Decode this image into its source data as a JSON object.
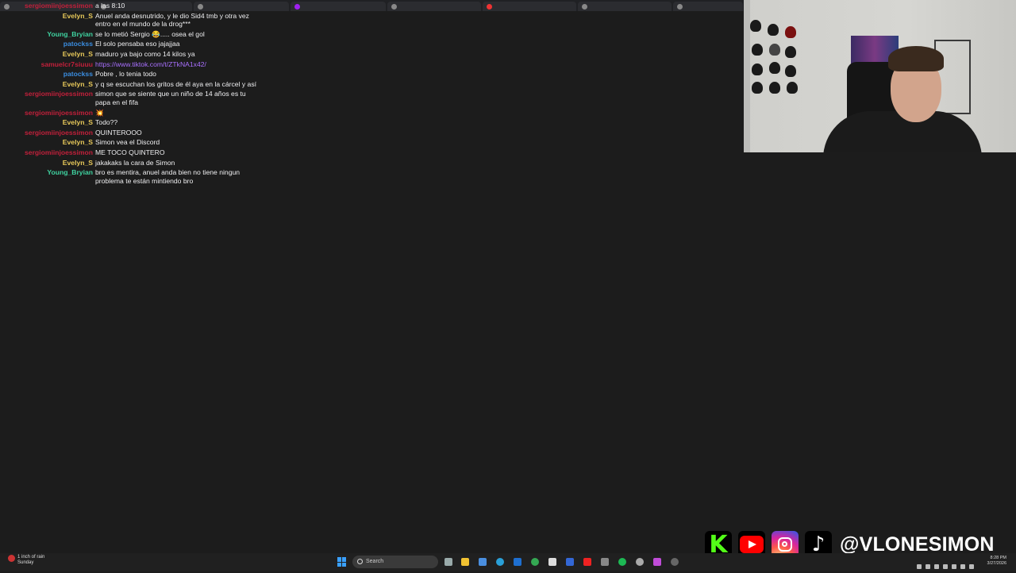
{
  "chat": {
    "messages": [
      {
        "user": "sergiomiinjoessimon",
        "color": "#c2203b",
        "text": "a las 8:10",
        "link": false
      },
      {
        "user": "Evelyn_S",
        "color": "#e8c95a",
        "text": "Anuel anda desnutrido, y le dio Sid4 tmb y otra vez entro en el mundo de la drog***",
        "link": false
      },
      {
        "user": "Young_Bryian",
        "color": "#3fd2a0",
        "text": "se lo metió Sergio 😂..... osea el gol",
        "link": false
      },
      {
        "user": "patockss",
        "color": "#3a8de0",
        "text": "El solo pensaba eso jajajjaa",
        "link": false
      },
      {
        "user": "Evelyn_S",
        "color": "#e8c95a",
        "text": "maduro ya bajo como 14 kilos ya",
        "link": false
      },
      {
        "user": "samuelcr7siuuu",
        "color": "#c2203b",
        "text": "https://www.tiktok.com/t/ZTkNA1x42/",
        "link": true
      },
      {
        "user": "patockss",
        "color": "#3a8de0",
        "text": "Pobre , lo tenia todo",
        "link": false
      },
      {
        "user": "Evelyn_S",
        "color": "#e8c95a",
        "text": "y q se escuchan los gritos de él aya en la cárcel y así",
        "link": false
      },
      {
        "user": "sergiomiinjoessimon",
        "color": "#c2203b",
        "text": "simon que se siente que un niño de 14 años es tu papa en el fifa",
        "link": false
      },
      {
        "user": "sergiomiinjoessimon",
        "color": "#c2203b",
        "text": "💥",
        "link": false
      },
      {
        "user": "Evelyn_S",
        "color": "#e8c95a",
        "text": "Todo??",
        "link": false
      },
      {
        "user": "sergiomiinjoessimon",
        "color": "#c2203b",
        "text": "QUINTEROOO",
        "link": false
      },
      {
        "user": "Evelyn_S",
        "color": "#e8c95a",
        "text": "Simon vea el Discord",
        "link": false
      },
      {
        "user": "sergiomiinjoessimon",
        "color": "#c2203b",
        "text": "ME TOCO QUINTERO",
        "link": false
      },
      {
        "user": "Evelyn_S",
        "color": "#e8c95a",
        "text": "jakakaks la cara de Simon",
        "link": false
      },
      {
        "user": "Young_Bryian",
        "color": "#3fd2a0",
        "text": "bro es mentira, anuel anda bien no tiene ningun problema te están mintiendo bro",
        "link": false
      }
    ]
  },
  "overlay": {
    "handle": "@VLONESIMON",
    "icons": [
      "kick-icon",
      "youtube-icon",
      "instagram-icon",
      "tiktok-icon"
    ]
  },
  "taskbar": {
    "weather_line1": "1 inch of rain",
    "weather_line2": "Sunday",
    "search_placeholder": "Search",
    "time": "8:28 PM",
    "date": "3/27/2026"
  }
}
